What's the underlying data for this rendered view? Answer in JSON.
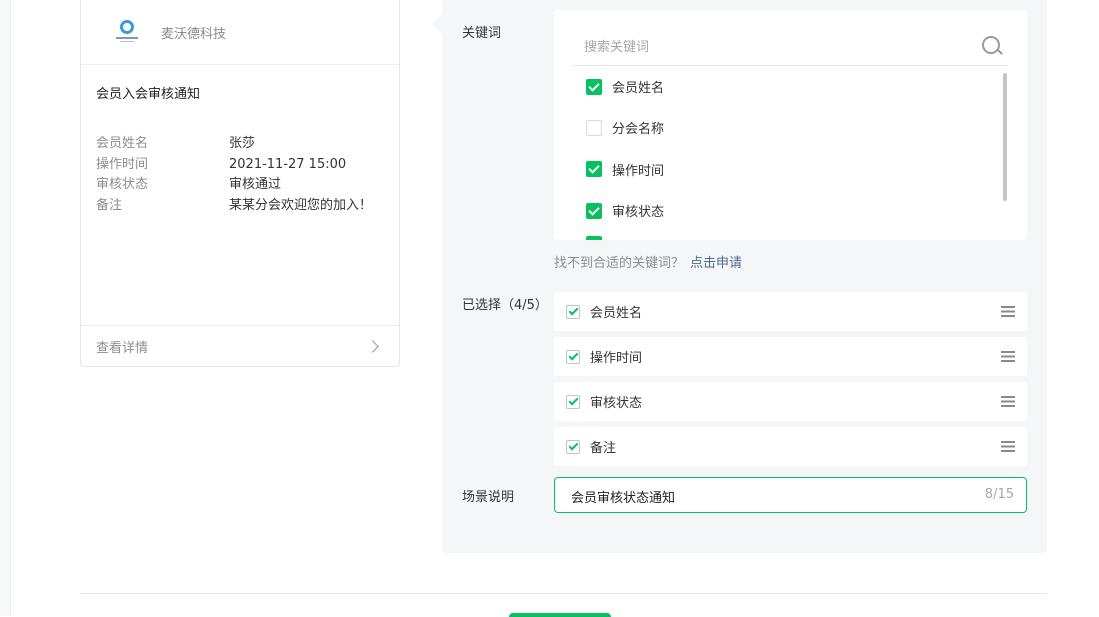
{
  "preview": {
    "brand": "麦沃德科技",
    "title": "会员入会审核通知",
    "fields": [
      {
        "key": "会员姓名",
        "value": "张莎"
      },
      {
        "key": "操作时间",
        "value": "2021-11-27 15:00"
      },
      {
        "key": "审核状态",
        "value": "审核通过"
      },
      {
        "key": "备注",
        "value": "某某分会欢迎您的加入！"
      }
    ],
    "detail_link": "查看详情"
  },
  "keywords": {
    "label": "关键词",
    "placeholder": "搜索关键词",
    "items": [
      {
        "label": "会员姓名",
        "checked": true
      },
      {
        "label": "分会名称",
        "checked": false
      },
      {
        "label": "操作时间",
        "checked": true
      },
      {
        "label": "审核状态",
        "checked": true
      }
    ],
    "hint": "找不到合适的关键词？",
    "apply_link": "点击申请"
  },
  "selected": {
    "label": "已选择（4/5）",
    "items": [
      "会员姓名",
      "操作时间",
      "审核状态",
      "备注"
    ]
  },
  "scene": {
    "label": "场景说明",
    "value": "会员审核状态通知",
    "counter": "8/15"
  },
  "colors": {
    "accent": "#07c160",
    "link": "#4b6a91"
  }
}
